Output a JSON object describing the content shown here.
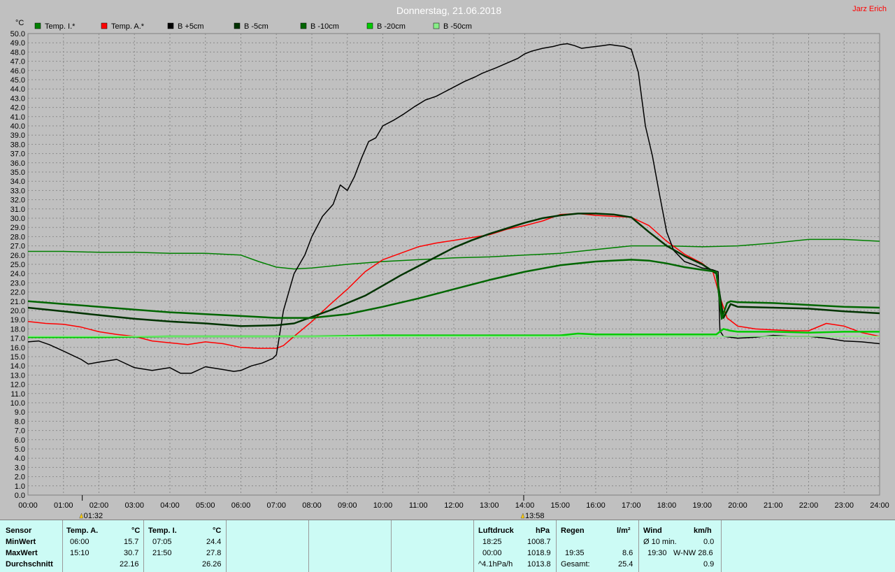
{
  "header": {
    "title": "Donnerstag, 21.06.2018",
    "author": "Jarz Erich",
    "unit_label": "°C"
  },
  "chart_data": {
    "type": "line",
    "title": "Donnerstag, 21.06.2018",
    "ylabel": "°C",
    "ylim": [
      0,
      50
    ],
    "yticks": [
      "0.0",
      "1.0",
      "2.0",
      "3.0",
      "4.0",
      "5.0",
      "6.0",
      "7.0",
      "8.0",
      "9.0",
      "10.0",
      "11.0",
      "12.0",
      "13.0",
      "14.0",
      "15.0",
      "16.0",
      "17.0",
      "18.0",
      "19.0",
      "20.0",
      "21.0",
      "22.0",
      "23.0",
      "24.0",
      "25.0",
      "26.0",
      "27.0",
      "28.0",
      "29.0",
      "30.0",
      "31.0",
      "32.0",
      "33.0",
      "34.0",
      "35.0",
      "36.0",
      "37.0",
      "38.0",
      "39.0",
      "40.0",
      "41.0",
      "42.0",
      "43.0",
      "44.0",
      "45.0",
      "46.0",
      "47.0",
      "48.0",
      "49.0",
      "50.0"
    ],
    "xlim": [
      0,
      24
    ],
    "xticks": [
      "00:00",
      "01:00",
      "02:00",
      "03:00",
      "04:00",
      "05:00",
      "06:00",
      "07:00",
      "08:00",
      "09:00",
      "10:00",
      "11:00",
      "12:00",
      "13:00",
      "14:00",
      "15:00",
      "16:00",
      "17:00",
      "18:00",
      "19:00",
      "20:00",
      "21:00",
      "22:00",
      "23:00",
      "24:00"
    ],
    "grid": true,
    "legend_position": "top",
    "markers": [
      {
        "x": 1.53,
        "label": "01:32"
      },
      {
        "x": 13.97,
        "label": "13:58"
      }
    ],
    "series": [
      {
        "name": "Temp. I.*",
        "color": "#008000",
        "width": 1.5,
        "x": [
          0,
          1,
          2,
          3,
          4,
          5,
          6,
          6.5,
          7,
          7.5,
          8,
          9,
          10,
          11,
          12,
          13,
          14,
          15,
          16,
          17,
          18,
          19,
          20,
          21,
          22,
          23,
          24
        ],
        "y": [
          26.4,
          26.4,
          26.3,
          26.3,
          26.2,
          26.2,
          26.0,
          25.3,
          24.7,
          24.5,
          24.6,
          25.0,
          25.3,
          25.5,
          25.7,
          25.8,
          26.0,
          26.2,
          26.6,
          27.0,
          27.0,
          26.9,
          27.0,
          27.3,
          27.7,
          27.7,
          27.5
        ]
      },
      {
        "name": "Temp. A.*",
        "color": "#ff0000",
        "width": 1.5,
        "x": [
          0,
          0.5,
          1,
          1.5,
          2,
          2.5,
          3,
          3.5,
          4,
          4.5,
          5,
          5.5,
          6,
          6.5,
          7,
          7.2,
          7.5,
          8,
          8.5,
          9,
          9.5,
          10,
          10.5,
          11,
          11.5,
          12,
          12.5,
          13,
          13.5,
          14,
          14.5,
          15,
          15.5,
          16,
          16.5,
          17,
          17.5,
          18,
          18.5,
          19,
          19.3,
          19.5,
          19.7,
          20,
          20.5,
          21,
          21.5,
          22,
          22.5,
          23,
          23.5,
          24
        ],
        "y": [
          18.8,
          18.6,
          18.5,
          18.2,
          17.7,
          17.4,
          17.2,
          16.7,
          16.5,
          16.3,
          16.6,
          16.4,
          16.0,
          15.9,
          15.9,
          16.2,
          17.2,
          18.8,
          20.6,
          22.3,
          24.2,
          25.5,
          26.2,
          26.9,
          27.3,
          27.6,
          27.9,
          28.2,
          28.8,
          29.2,
          29.7,
          30.4,
          30.5,
          30.3,
          30.2,
          30.1,
          29.2,
          27.5,
          26.1,
          25.1,
          24.2,
          21.5,
          19.2,
          18.3,
          18.0,
          17.9,
          17.8,
          17.8,
          18.6,
          18.3,
          17.6,
          17.2
        ]
      },
      {
        "name": "B +5cm",
        "color": "#000000",
        "width": 1.5,
        "x": [
          0,
          0.3,
          0.6,
          1,
          1.5,
          1.7,
          2,
          2.5,
          3,
          3.5,
          4,
          4.3,
          4.6,
          5,
          5.5,
          5.8,
          6,
          6.3,
          6.6,
          6.9,
          7.0,
          7.2,
          7.5,
          7.8,
          8.0,
          8.3,
          8.6,
          8.8,
          9.0,
          9.2,
          9.4,
          9.6,
          9.8,
          10.0,
          10.3,
          10.6,
          10.9,
          11.2,
          11.5,
          11.8,
          12.0,
          12.3,
          12.6,
          12.8,
          13.0,
          13.2,
          13.5,
          13.8,
          14.0,
          14.2,
          14.5,
          14.8,
          15.0,
          15.2,
          15.4,
          15.6,
          15.8,
          16.0,
          16.2,
          16.4,
          16.6,
          16.8,
          17.0,
          17.2,
          17.4,
          17.6,
          17.8,
          18.0,
          18.2,
          18.5,
          18.8,
          19.0,
          19.3,
          19.45,
          19.5,
          19.6,
          20.0,
          20.5,
          21.0,
          21.5,
          22.0,
          22.5,
          23.0,
          23.5,
          24.0
        ],
        "y": [
          16.6,
          16.7,
          16.3,
          15.6,
          14.7,
          14.2,
          14.4,
          14.7,
          13.8,
          13.5,
          13.8,
          13.2,
          13.2,
          13.9,
          13.6,
          13.4,
          13.5,
          14.0,
          14.3,
          14.8,
          15.2,
          20.0,
          24.0,
          26.0,
          28.0,
          30.2,
          31.5,
          33.6,
          33.0,
          34.5,
          36.5,
          38.3,
          38.7,
          40.0,
          40.6,
          41.3,
          42.1,
          42.8,
          43.2,
          43.8,
          44.2,
          44.8,
          45.3,
          45.7,
          46.0,
          46.3,
          46.8,
          47.3,
          47.8,
          48.1,
          48.4,
          48.6,
          48.8,
          48.9,
          48.7,
          48.4,
          48.5,
          48.6,
          48.7,
          48.8,
          48.7,
          48.6,
          48.3,
          45.8,
          40.0,
          36.7,
          32.5,
          28.5,
          26.5,
          25.3,
          24.9,
          24.6,
          24.4,
          24.2,
          17.8,
          17.2,
          17.0,
          17.1,
          17.3,
          17.2,
          17.2,
          17.0,
          16.7,
          16.6,
          16.4
        ]
      },
      {
        "name": "B -5cm",
        "color": "#003300",
        "width": 2.5,
        "x": [
          0,
          1,
          2,
          3,
          4,
          5,
          6,
          7,
          7.5,
          8,
          8.5,
          9,
          9.5,
          10,
          10.5,
          11,
          11.5,
          12,
          12.5,
          13,
          13.5,
          14,
          14.5,
          15,
          15.5,
          16,
          16.5,
          17,
          17.5,
          18,
          18.5,
          19,
          19.4,
          19.6,
          19.8,
          20,
          21,
          22,
          23,
          24
        ],
        "y": [
          20.3,
          19.9,
          19.5,
          19.1,
          18.8,
          18.6,
          18.3,
          18.4,
          18.6,
          19.3,
          20.0,
          20.8,
          21.6,
          22.7,
          23.8,
          24.8,
          25.8,
          26.8,
          27.6,
          28.3,
          28.9,
          29.5,
          30.0,
          30.3,
          30.5,
          30.5,
          30.4,
          30.1,
          28.5,
          27.0,
          25.9,
          25.0,
          24.0,
          19.2,
          20.7,
          20.4,
          20.3,
          20.2,
          19.9,
          19.7
        ]
      },
      {
        "name": "B -10cm",
        "color": "#006600",
        "width": 2.5,
        "x": [
          0,
          1,
          2,
          3,
          4,
          5,
          6,
          7,
          7.5,
          8,
          9,
          10,
          11,
          12,
          13,
          14,
          15,
          16,
          17,
          17.5,
          18,
          18.5,
          19,
          19.4,
          19.55,
          19.7,
          19.8,
          20,
          21,
          22,
          23,
          24
        ],
        "y": [
          21.0,
          20.7,
          20.4,
          20.1,
          19.8,
          19.6,
          19.4,
          19.2,
          19.2,
          19.2,
          19.6,
          20.4,
          21.3,
          22.3,
          23.3,
          24.2,
          24.9,
          25.3,
          25.5,
          25.4,
          25.1,
          24.7,
          24.4,
          24.2,
          19.1,
          20.8,
          21.0,
          20.9,
          20.8,
          20.6,
          20.4,
          20.3
        ]
      },
      {
        "name": "B -20cm",
        "color": "#00cc00",
        "width": 2.5,
        "x": [
          0,
          2,
          4,
          6,
          8,
          10,
          12,
          14,
          15,
          15.5,
          16,
          18,
          19.4,
          19.6,
          19.8,
          20,
          21,
          22,
          23,
          24
        ],
        "y": [
          17.1,
          17.1,
          17.2,
          17.2,
          17.2,
          17.3,
          17.3,
          17.3,
          17.3,
          17.5,
          17.4,
          17.4,
          17.4,
          18.0,
          17.8,
          17.7,
          17.7,
          17.6,
          17.7,
          17.7
        ]
      },
      {
        "name": "B -50cm",
        "color": "#88ee88",
        "width": 1.5,
        "x": [
          0,
          24
        ],
        "y": [
          17.2,
          17.2
        ]
      }
    ]
  },
  "stats": {
    "sensor": {
      "header": "Sensor",
      "min": "MinWert",
      "max": "MaxWert",
      "avg": "Durchschnitt"
    },
    "temp_a": {
      "header": "Temp. A.",
      "unit": "°C",
      "min_time": "06:00",
      "min_val": "15.7",
      "max_time": "15:10",
      "max_val": "30.7",
      "avg": "22.16"
    },
    "temp_i": {
      "header": "Temp. I.",
      "unit": "°C",
      "min_time": "07:05",
      "min_val": "24.4",
      "max_time": "21:50",
      "max_val": "27.8",
      "avg": "26.26"
    },
    "pressure": {
      "header": "Luftdruck",
      "unit": "hPa",
      "min_time": "18:25",
      "min_val": "1008.7",
      "max_time": "00:00",
      "max_val": "1018.9",
      "trend": "^4.1hPa/h",
      "avg": "1013.8"
    },
    "rain": {
      "header": "Regen",
      "unit": "l/m²",
      "max_time": "19:35",
      "max_val": "8.6",
      "total_label": "Gesamt:",
      "total": "25.4"
    },
    "wind": {
      "header": "Wind",
      "unit": "km/h",
      "avg_label": "Ø 10 min.",
      "avg_val": "0.0",
      "max_time": "19:30",
      "max_dir_val": "W-NW 28.6",
      "third": "0.9"
    }
  }
}
